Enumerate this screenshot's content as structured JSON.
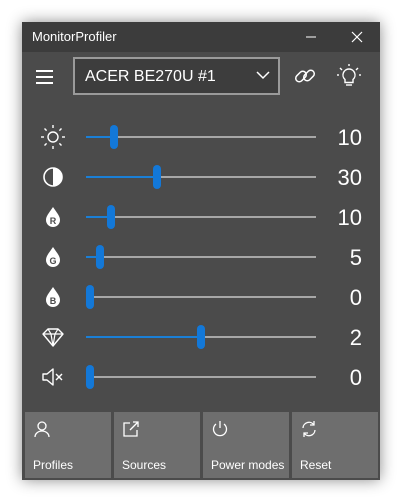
{
  "window": {
    "title": "MonitorProfiler"
  },
  "toolbar": {
    "monitor_selected": "ACER BE270U #1"
  },
  "sliders": [
    {
      "name": "brightness",
      "icon": "sun-icon",
      "value": "10",
      "level": 0.12
    },
    {
      "name": "contrast",
      "icon": "contrast-icon",
      "value": "30",
      "level": 0.31
    },
    {
      "name": "red",
      "icon": "red-drop-icon",
      "value": "10",
      "level": 0.11
    },
    {
      "name": "green",
      "icon": "green-drop-icon",
      "value": "5",
      "level": 0.06
    },
    {
      "name": "blue",
      "icon": "blue-drop-icon",
      "value": "0",
      "level": 0.0
    },
    {
      "name": "color-preset",
      "icon": "diamond-icon",
      "value": "2",
      "level": 0.5
    },
    {
      "name": "volume",
      "icon": "mute-icon",
      "value": "0",
      "level": 0.0
    }
  ],
  "bottom_buttons": [
    {
      "label": "Profiles",
      "icon": "person-icon"
    },
    {
      "label": "Sources",
      "icon": "external-link-icon"
    },
    {
      "label": "Power modes",
      "icon": "power-icon"
    },
    {
      "label": "Reset",
      "icon": "refresh-icon"
    }
  ],
  "colors": {
    "accent": "#1378d8",
    "window_bg": "#4b4b4b",
    "button_bg": "#6e6e6e"
  }
}
